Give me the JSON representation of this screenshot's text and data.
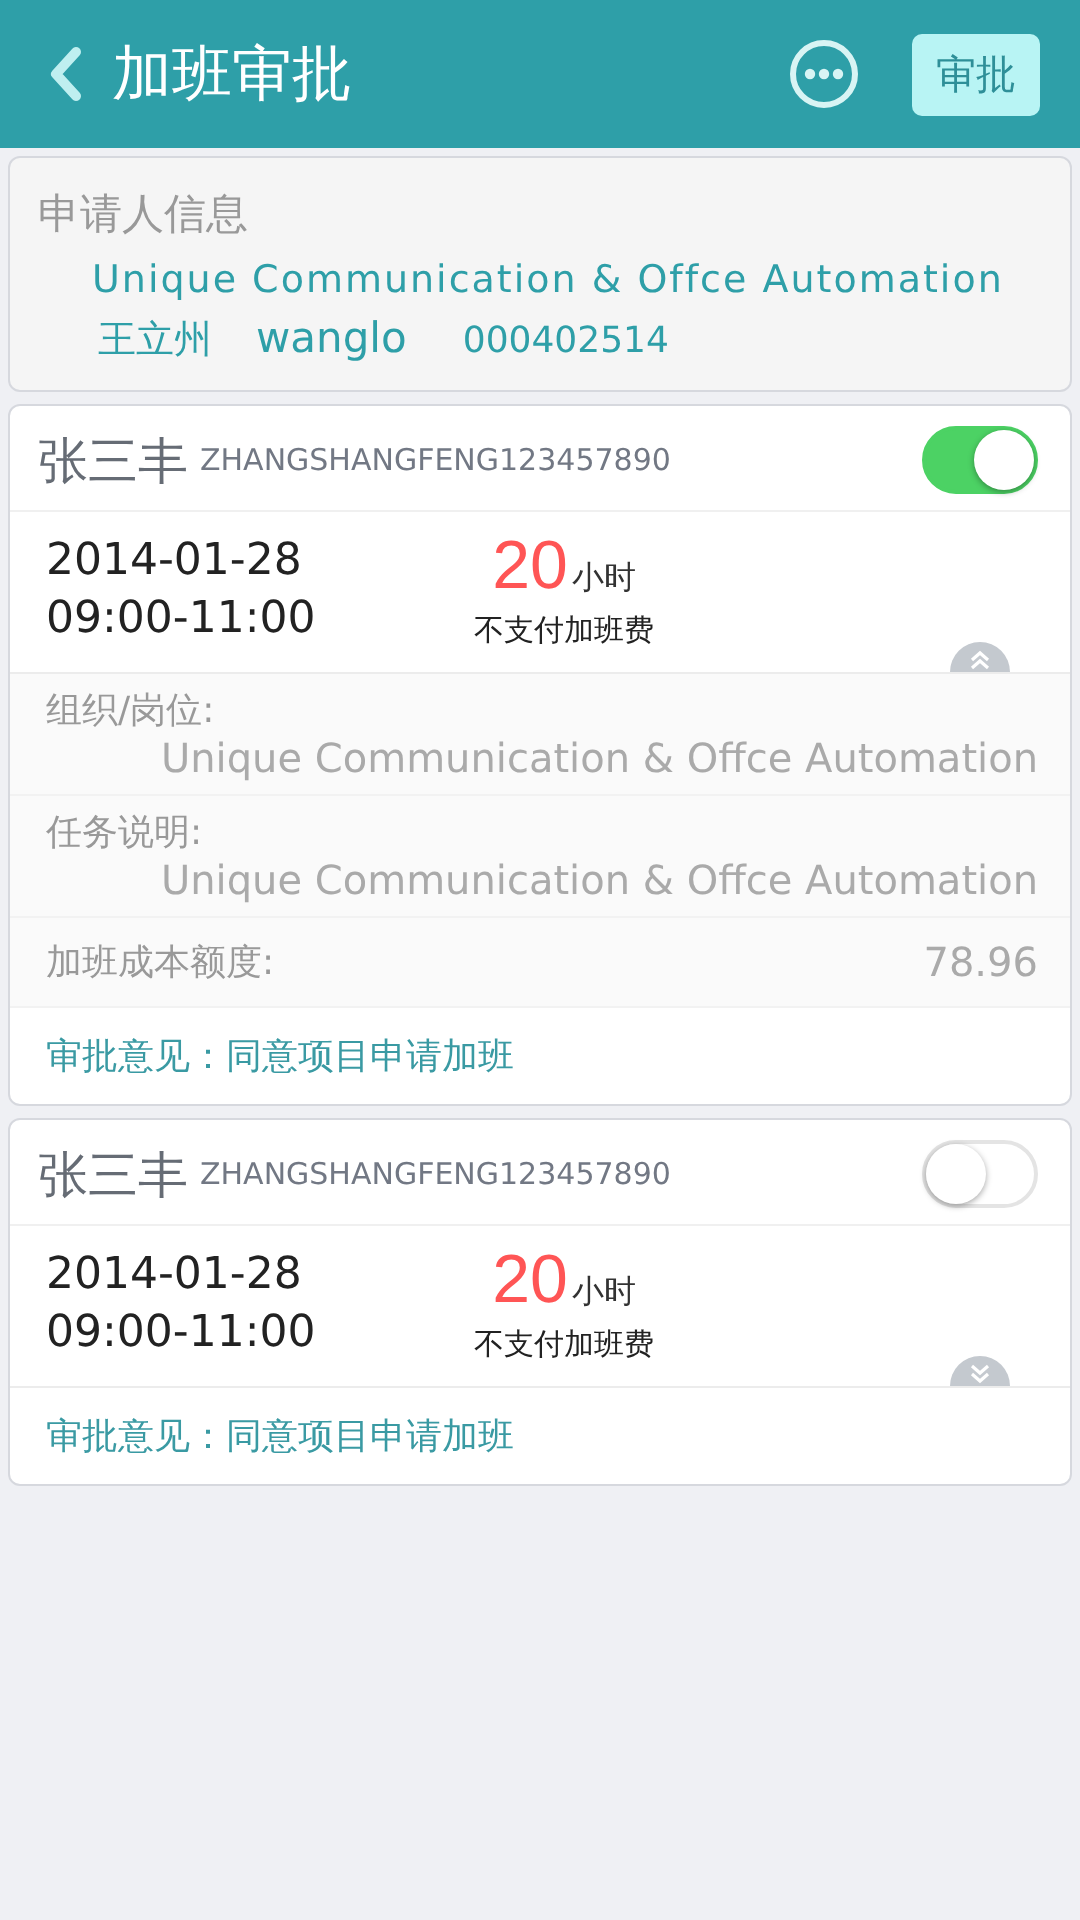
{
  "header": {
    "title": "加班审批",
    "action": "审批"
  },
  "applicant": {
    "heading": "申请人信息",
    "org": "Unique Communication & Offce Automation",
    "name": "王立州",
    "account": "wanglo",
    "id": "000402514"
  },
  "records": [
    {
      "name": "张三丰",
      "code": "ZHANGSHANGFENG123457890",
      "on": true,
      "expanded": true,
      "date": "2014-01-28",
      "time": "09:00-11:00",
      "hours": "20",
      "unit": "小时",
      "pay": "不支付加班费",
      "details": [
        {
          "label": "组织/岗位:",
          "value": "Unique Communication & Offce Automation",
          "kind": "stacked"
        },
        {
          "label": "任务说明:",
          "value": "Unique Communication & Offce Automation",
          "kind": "stacked"
        },
        {
          "label": "加班成本额度:",
          "value": "78.96",
          "kind": "inline"
        }
      ],
      "opinion": "审批意见：同意项目申请加班"
    },
    {
      "name": "张三丰",
      "code": "ZHANGSHANGFENG123457890",
      "on": false,
      "expanded": false,
      "date": "2014-01-28",
      "time": "09:00-11:00",
      "hours": "20",
      "unit": "小时",
      "pay": "不支付加班费",
      "opinion": "审批意见：同意项目申请加班"
    }
  ]
}
